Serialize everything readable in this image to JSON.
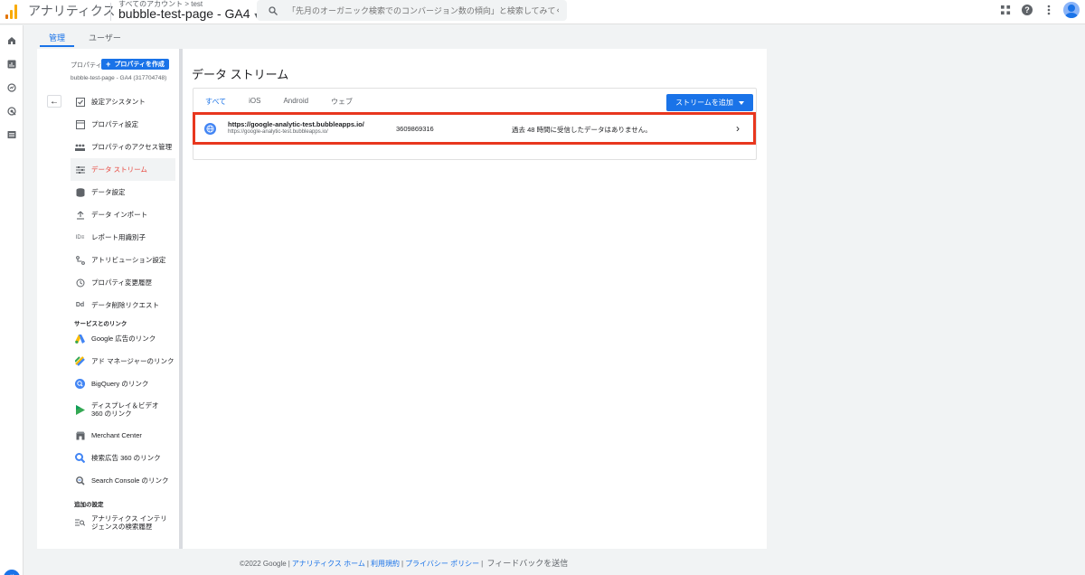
{
  "topbar": {
    "app_name": "アナリティクス",
    "breadcrumb": "すべてのアカウント > test",
    "property_title": "bubble-test-page - GA4",
    "search_placeholder": "「先月のオーガニック検索でのコンバージョン数の傾向」と検索してみてく…"
  },
  "admin_tabs": [
    {
      "label": "管理"
    },
    {
      "label": "ユーザー"
    }
  ],
  "property_column": {
    "label": "プロパティ",
    "create_button": "プロパティを作成",
    "property_name": "bubble-test-page - GA4 (317704748)",
    "menu_items": [
      {
        "label": "設定アシスタント",
        "icon": "checkbox-icon"
      },
      {
        "label": "プロパティ設定",
        "icon": "property-settings-icon"
      },
      {
        "label": "プロパティのアクセス管理",
        "icon": "people-icon"
      },
      {
        "label": "データ ストリーム",
        "icon": "data-streams-icon"
      },
      {
        "label": "データ設定",
        "icon": "database-icon"
      },
      {
        "label": "データ インポート",
        "icon": "upload-icon"
      },
      {
        "label": "レポート用識別子",
        "icon": "identifier-icon"
      },
      {
        "label": "アトリビューション設定",
        "icon": "attribution-icon"
      },
      {
        "label": "プロパティ変更履歴",
        "icon": "history-icon"
      },
      {
        "label": "データ削除リクエスト",
        "icon": "dd-icon"
      }
    ],
    "links_section_title": "サービスとのリンク",
    "link_items": [
      {
        "label": "Google 広告のリンク",
        "icon": "google-ads-icon"
      },
      {
        "label": "アド マネージャーのリンク",
        "icon": "ad-manager-icon"
      },
      {
        "label": "BigQuery のリンク",
        "icon": "bigquery-icon"
      },
      {
        "label": "ディスプレイ＆ビデオ 360 のリンク",
        "icon": "dv360-icon"
      },
      {
        "label": "Merchant Center",
        "icon": "merchant-center-icon"
      },
      {
        "label": "検索広告 360 のリンク",
        "icon": "search-ads-360-icon"
      },
      {
        "label": "Search Console のリンク",
        "icon": "search-console-icon"
      }
    ],
    "additional_section_title": "追加の設定",
    "additional_items": [
      {
        "label": "アナリティクス インテリジェンスの検索履歴",
        "icon": "intelligence-history-icon"
      }
    ]
  },
  "main": {
    "title": "データ ストリーム",
    "tabs": [
      {
        "label": "すべて"
      },
      {
        "label": "iOS"
      },
      {
        "label": "Android"
      },
      {
        "label": "ウェブ"
      }
    ],
    "add_stream_button": "ストリームを追加",
    "stream": {
      "name": "https://google-analytic-test.bubbleapps.io/",
      "url": "https://google-analytic-test.bubbleapps.io/",
      "id": "3609869316",
      "status": "過去 48 時間に受信したデータはありません。"
    }
  },
  "footer": {
    "copyright": "©2022 Google",
    "links": [
      "アナリティクス ホーム",
      "利用規約",
      "プライバシー ポリシー"
    ],
    "feedback": "フィードバックを送信"
  },
  "colors": {
    "accent": "#1a73e8",
    "highlight_border": "#e8371e",
    "active_menu_text": "#e8453c"
  }
}
